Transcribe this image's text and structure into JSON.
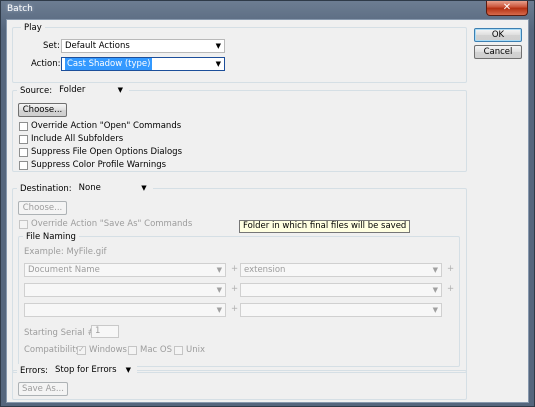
{
  "window": {
    "title": "Batch",
    "close_glyph": "✕"
  },
  "buttons": {
    "ok": "OK",
    "cancel": "Cancel"
  },
  "play": {
    "legend": "Play",
    "set_label": "Set:",
    "set_value": "Default Actions",
    "action_label": "Action:",
    "action_value": "Cast Shadow (type)"
  },
  "source": {
    "label": "Source:",
    "value": "Folder",
    "choose_label": "Choose...",
    "options": [
      "Override Action \"Open\" Commands",
      "Include All Subfolders",
      "Suppress File Open Options Dialogs",
      "Suppress Color Profile Warnings"
    ]
  },
  "destination": {
    "label": "Destination:",
    "value": "None",
    "choose_label": "Choose...",
    "override_label": "Override Action \"Save As\" Commands",
    "tooltip": "Folder in which final files will be saved"
  },
  "file_naming": {
    "legend": "File Naming",
    "example": "Example: MyFile.gif",
    "row1_left": "Document Name",
    "row1_right": "extension",
    "plus": "+",
    "serial_label": "Starting Serial #:",
    "serial_value": "1",
    "compat_label": "Compatibility:",
    "compat_windows": "Windows",
    "compat_macos": "Mac OS",
    "compat_unix": "Unix"
  },
  "errors": {
    "label": "Errors:",
    "value": "Stop for Errors",
    "save_as_label": "Save As..."
  },
  "icons": {
    "dropdown": "▼"
  }
}
